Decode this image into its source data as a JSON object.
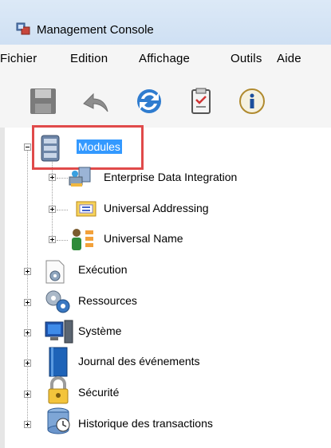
{
  "window": {
    "title": "Management Console"
  },
  "menu": [
    "Fichier",
    "Edition",
    "Affichage",
    "Outils",
    "Aide"
  ],
  "toolbar": {
    "buttons": [
      {
        "name": "save-icon"
      },
      {
        "name": "undo-icon"
      },
      {
        "name": "refresh-icon"
      },
      {
        "name": "clipboard-icon"
      },
      {
        "name": "info-icon"
      }
    ]
  },
  "tree": {
    "root": "Modules",
    "modules": [
      "Enterprise Data Integration",
      "Universal Addressing",
      "Universal Name"
    ],
    "nodes": [
      "Exécution",
      "Ressources",
      "Système",
      "Journal des événements",
      "Sécurité",
      "Historique des transactions"
    ]
  },
  "colors": {
    "selection": "#3399ff",
    "highlight": "#e04a4a"
  }
}
